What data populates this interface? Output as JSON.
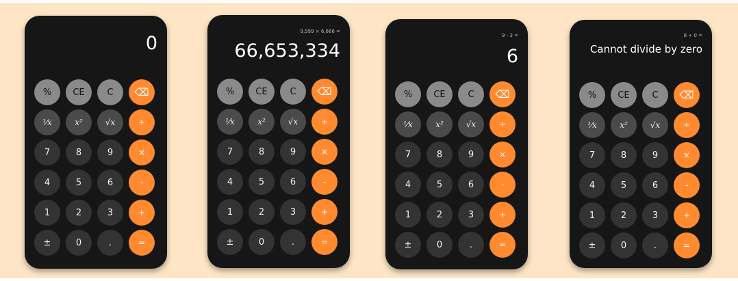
{
  "screens": [
    {
      "expression": "",
      "display": "0"
    },
    {
      "expression": "9,999 × 6,666 =",
      "display": "66,653,334"
    },
    {
      "expression": "9 - 3 =",
      "display": "6"
    },
    {
      "expression": "8 ÷ 0 =",
      "display": "Cannot divide by zero"
    }
  ],
  "keys": {
    "percent": "%",
    "clear_entry": "CE",
    "clear": "C",
    "backspace": "⌫",
    "reciprocal": "¹⁄𝑥",
    "square": "𝑥²",
    "sqrt": "√𝑥",
    "divide": "÷",
    "seven": "7",
    "eight": "8",
    "nine": "9",
    "multiply": "×",
    "four": "4",
    "five": "5",
    "six": "6",
    "subtract": "-",
    "one": "1",
    "two": "2",
    "three": "3",
    "add": "+",
    "negate": "±",
    "zero": "0",
    "decimal": ".",
    "equals": "="
  },
  "colors": {
    "background": "#fde5c6",
    "phone": "#161616",
    "function_key": "#8a8a8a",
    "fx_key": "#4a4a4a",
    "number_key": "#333333",
    "operator_key": "#ff8a30"
  }
}
